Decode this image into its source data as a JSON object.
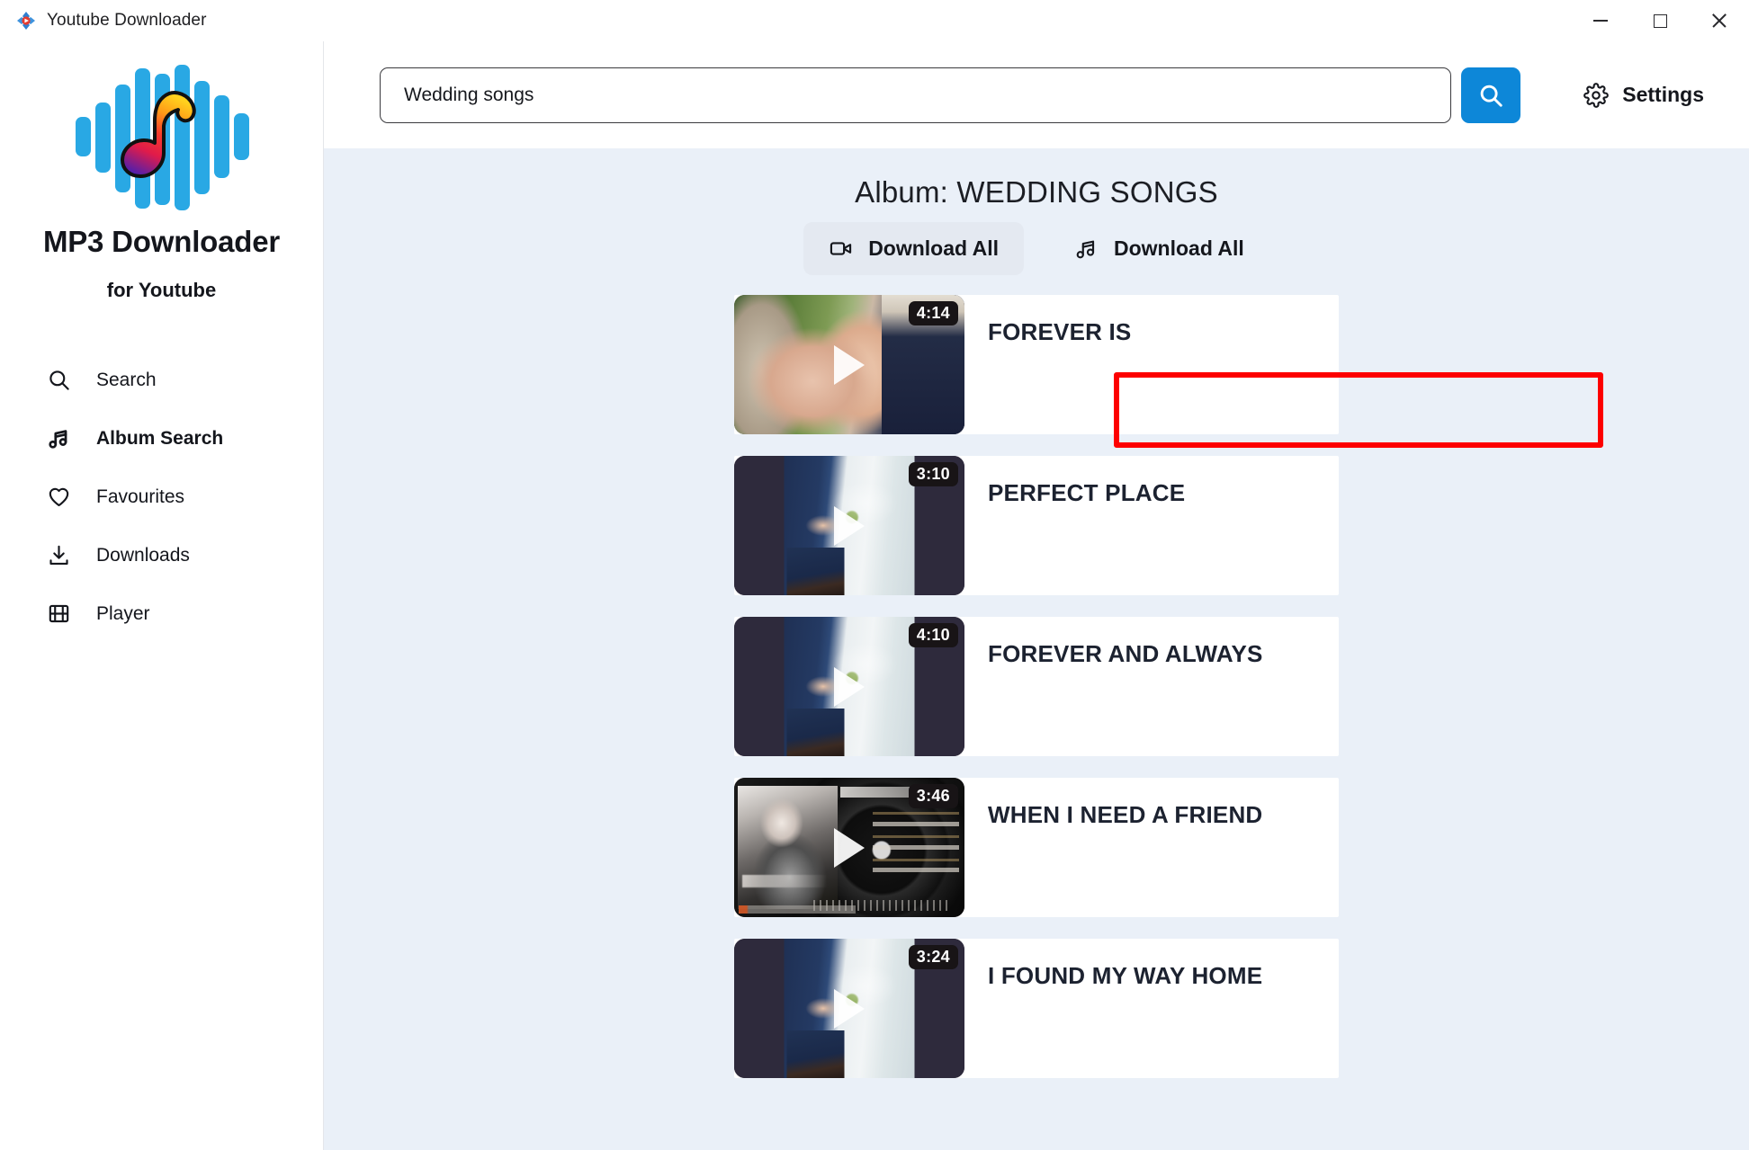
{
  "window": {
    "title": "Youtube Downloader",
    "app_icon": "youtube-downloader-icon",
    "controls": {
      "minimize": "minimize",
      "maximize": "maximize",
      "close": "close"
    }
  },
  "sidebar": {
    "logo_icon": "mp3-waveform-note-logo",
    "brand_title": "MP3 Downloader",
    "brand_subtitle": "for Youtube",
    "items": [
      {
        "label": "Search",
        "icon": "search-icon",
        "active": false
      },
      {
        "label": "Album Search",
        "icon": "music-note-icon",
        "active": true
      },
      {
        "label": "Favourites",
        "icon": "heart-icon",
        "active": false
      },
      {
        "label": "Downloads",
        "icon": "download-icon",
        "active": false
      },
      {
        "label": "Player",
        "icon": "film-strip-icon",
        "active": false
      }
    ]
  },
  "search": {
    "value": "Wedding songs",
    "placeholder": "Search",
    "button_icon": "search-icon",
    "button_color": "#0d87d8",
    "settings_label": "Settings",
    "settings_icon": "gear-icon"
  },
  "content": {
    "album_title": "Album: WEDDING SONGS",
    "download_buttons": [
      {
        "label": "Download All",
        "icon": "video-camera-icon",
        "hovered": true
      },
      {
        "label": "Download All",
        "icon": "music-note-icon",
        "hovered": false
      }
    ],
    "annotation": {
      "type": "red-rectangle",
      "color": "#fd0000"
    },
    "songs": [
      {
        "title": "FOREVER IS",
        "duration": "4:14",
        "art": "art-hands",
        "play_icon": "play-icon"
      },
      {
        "title": "PERFECT PLACE",
        "duration": "3:10",
        "art": "art-wedding",
        "play_icon": "play-icon"
      },
      {
        "title": "FOREVER AND ALWAYS",
        "duration": "4:10",
        "art": "art-wedding",
        "play_icon": "play-icon"
      },
      {
        "title": "WHEN I NEED A FRIEND",
        "duration": "3:46",
        "art": "art-vinyl",
        "play_icon": "play-icon"
      },
      {
        "title": "I FOUND MY WAY HOME",
        "duration": "3:24",
        "art": "art-wedding",
        "play_icon": "play-icon"
      }
    ]
  },
  "colors": {
    "accent": "#0d87d8",
    "content_bg": "#eaf0f8",
    "annotation": "#fd0000",
    "logo_bars": "#29a8e4"
  }
}
